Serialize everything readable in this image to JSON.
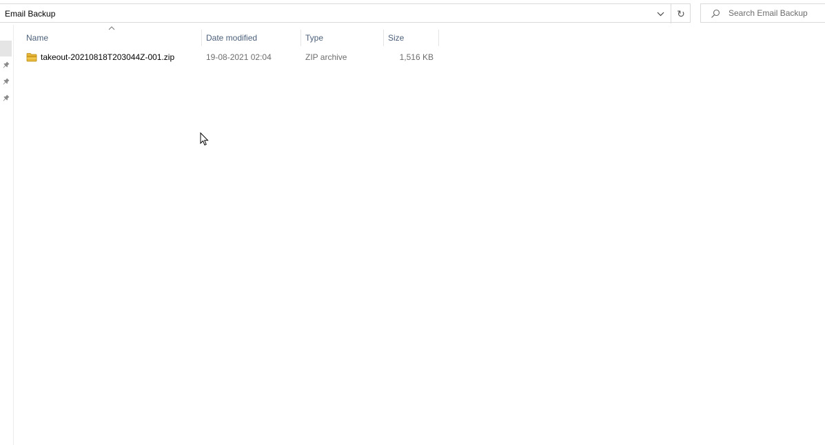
{
  "address_bar": {
    "path": "Email Backup",
    "dropdown_icon": "chevron-down-icon",
    "refresh_icon": "refresh-icon",
    "refresh_glyph": "↻"
  },
  "search": {
    "placeholder": "Search Email Backup",
    "value": "",
    "icon": "search-icon"
  },
  "nav": {
    "pinned_count": 3,
    "pin_icon": "pin-icon"
  },
  "columns": {
    "name": "Name",
    "date_modified": "Date modified",
    "type": "Type",
    "size": "Size",
    "sort_column": "name",
    "sort_direction": "ascending"
  },
  "files": [
    {
      "name": "takeout-20210818T203044Z-001.zip",
      "date_modified": "19-08-2021 02:04",
      "type": "ZIP archive",
      "size": "1,516 KB",
      "icon": "zip-folder-icon"
    }
  ],
  "colors": {
    "header_text": "#4c607a",
    "secondary_text": "#6d6d6d",
    "zip_icon": "#e8b838"
  }
}
